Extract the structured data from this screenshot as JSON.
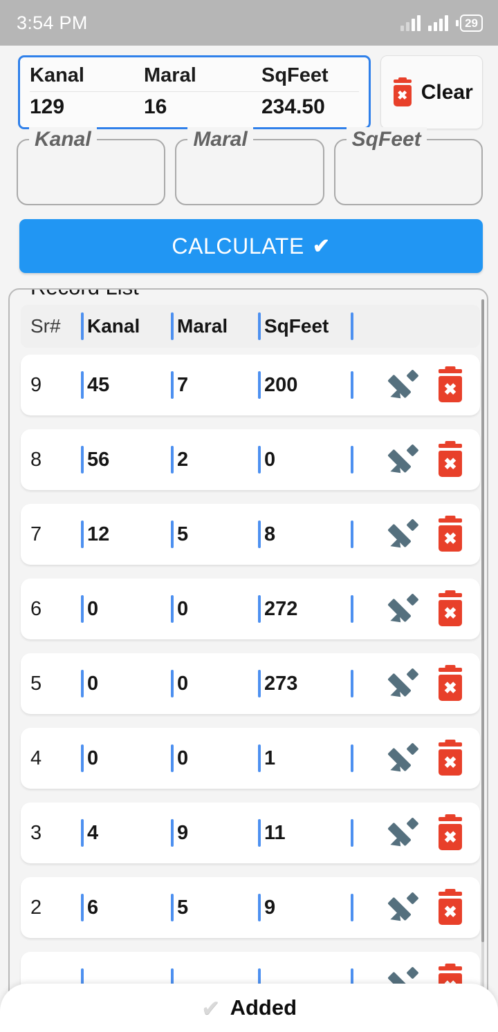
{
  "status_bar": {
    "time": "3:54 PM",
    "battery_level": "29",
    "signal_icon": "signal-bars-icon",
    "battery_icon": "battery-icon"
  },
  "summary": {
    "headers": [
      "Kanal",
      "Maral",
      "SqFeet"
    ],
    "values": [
      "129",
      "16",
      "234.50"
    ],
    "border_color": "#2f80ea"
  },
  "clear_button": {
    "label": "Clear",
    "icon": "trash-icon",
    "icon_glyph": "✖"
  },
  "inputs": [
    {
      "label": "Kanal",
      "value": "",
      "placeholder": ""
    },
    {
      "label": "Maral",
      "value": "",
      "placeholder": ""
    },
    {
      "label": "SqFeet",
      "value": "",
      "placeholder": ""
    }
  ],
  "calculate_button": {
    "label": "CALCULATE",
    "check_glyph": "✔",
    "color": "#2196f3"
  },
  "record_list": {
    "legend": "Record List",
    "columns": [
      "Sr#",
      "Kanal",
      "Maral",
      "SqFeet"
    ],
    "separator_color": "#4d90f0",
    "rows": [
      {
        "sr": "9",
        "kanal": "45",
        "maral": "7",
        "sqfeet": "200"
      },
      {
        "sr": "8",
        "kanal": "56",
        "maral": "2",
        "sqfeet": "0"
      },
      {
        "sr": "7",
        "kanal": "12",
        "maral": "5",
        "sqfeet": "8"
      },
      {
        "sr": "6",
        "kanal": "0",
        "maral": "0",
        "sqfeet": "272"
      },
      {
        "sr": "5",
        "kanal": "0",
        "maral": "0",
        "sqfeet": "273"
      },
      {
        "sr": "4",
        "kanal": "0",
        "maral": "0",
        "sqfeet": "1"
      },
      {
        "sr": "3",
        "kanal": "4",
        "maral": "9",
        "sqfeet": "11"
      },
      {
        "sr": "2",
        "kanal": "6",
        "maral": "5",
        "sqfeet": "9"
      },
      {
        "sr": "",
        "kanal": "",
        "maral": "",
        "sqfeet": ""
      }
    ],
    "row_actions": {
      "edit_icon": "pencil-icon",
      "delete_icon": "trash-icon",
      "delete_glyph": "✖"
    }
  },
  "toast": {
    "check_glyph": "✔",
    "message": "Added"
  }
}
